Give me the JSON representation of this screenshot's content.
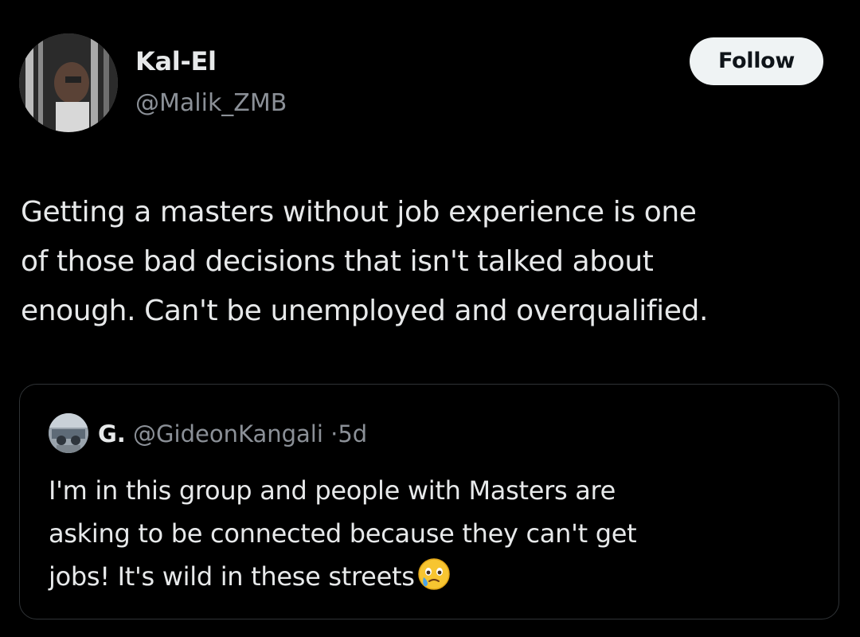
{
  "tweet": {
    "author": {
      "display_name": "Kal-El",
      "handle": "@Malik_ZMB",
      "avatar_icon": "profile-photo"
    },
    "follow_label": "Follow",
    "text": "Getting a masters without job experience is one\nof those bad decisions that isn't talked about\nenough. Can't be unemployed and overqualified."
  },
  "quoted_tweet": {
    "author": {
      "display_name": "G.",
      "handle": "@GideonKangali",
      "avatar_icon": "profile-photo"
    },
    "separator": "·",
    "timestamp": "5d",
    "text": "I'm in this group and people with Masters are\nasking to be connected because they can't get\njobs! It's wild in these streets",
    "emoji": "face-holding-back-tears"
  },
  "colors": {
    "background": "#000000",
    "text_primary": "#e7e9ea",
    "text_secondary": "#8b9097",
    "border": "#2f3336",
    "follow_button_bg": "#eff3f4"
  }
}
